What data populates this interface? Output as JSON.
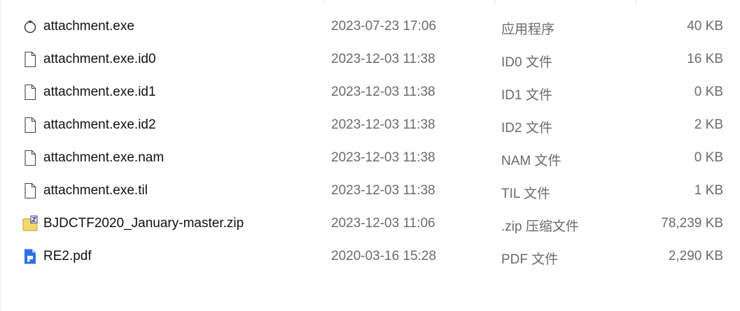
{
  "files": [
    {
      "name": "attachment.exe",
      "modified": "2023-07-23 17:06",
      "type": "应用程序",
      "size": "40 KB",
      "icon": "exe-app-icon"
    },
    {
      "name": "attachment.exe.id0",
      "modified": "2023-12-03 11:38",
      "type": "ID0 文件",
      "size": "16 KB",
      "icon": "file-icon"
    },
    {
      "name": "attachment.exe.id1",
      "modified": "2023-12-03 11:38",
      "type": "ID1 文件",
      "size": "0 KB",
      "icon": "file-icon"
    },
    {
      "name": "attachment.exe.id2",
      "modified": "2023-12-03 11:38",
      "type": "ID2 文件",
      "size": "2 KB",
      "icon": "file-icon"
    },
    {
      "name": "attachment.exe.nam",
      "modified": "2023-12-03 11:38",
      "type": "NAM 文件",
      "size": "0 KB",
      "icon": "file-icon"
    },
    {
      "name": "attachment.exe.til",
      "modified": "2023-12-03 11:38",
      "type": "TIL 文件",
      "size": "1 KB",
      "icon": "file-icon"
    },
    {
      "name": "BJDCTF2020_January-master.zip",
      "modified": "2023-12-03 11:06",
      "type": ".zip 压缩文件",
      "size": "78,239 KB",
      "icon": "zip-archive-icon"
    },
    {
      "name": "RE2.pdf",
      "modified": "2020-03-16 15:28",
      "type": "PDF 文件",
      "size": "2,290 KB",
      "icon": "pdf-icon"
    }
  ],
  "colors": {
    "text_primary": "#111111",
    "text_secondary": "#6b6b6b",
    "zip_yellow": "#f5d76e",
    "pdf_blue": "#2f6fe4"
  }
}
